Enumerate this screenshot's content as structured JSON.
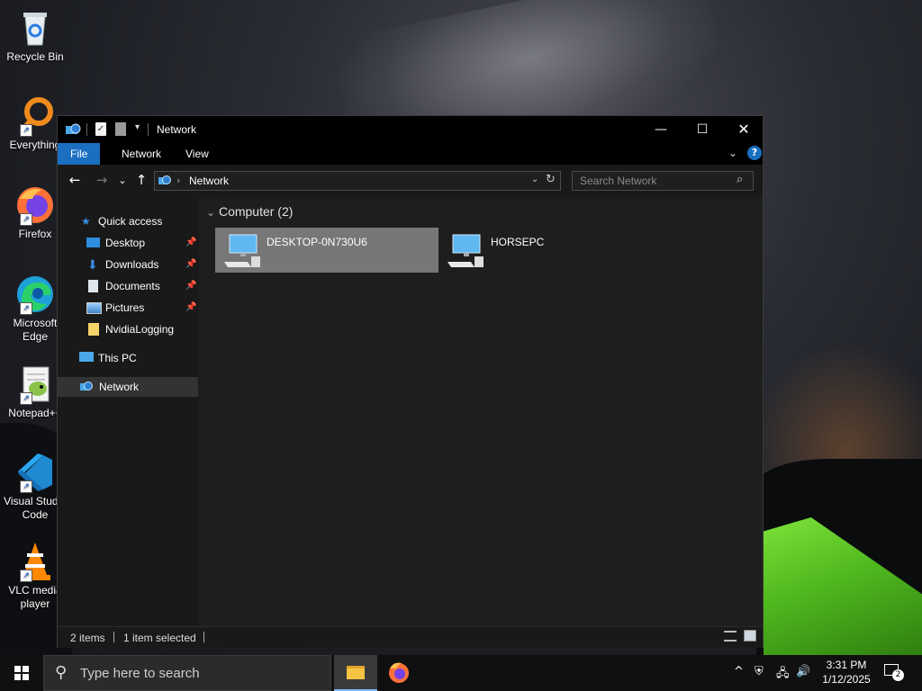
{
  "desktop": {
    "icons": [
      {
        "label": "Recycle Bin",
        "icon": "recycle-bin-icon"
      },
      {
        "label": "Everything",
        "icon": "everything-icon"
      },
      {
        "label": "Firefox",
        "icon": "firefox-icon"
      },
      {
        "label": "Microsoft Edge",
        "label_l1": "Microsoft",
        "label_l2": "Edge",
        "icon": "edge-icon"
      },
      {
        "label": "Notepad++",
        "icon": "notepadpp-icon"
      },
      {
        "label": "Visual Studio Code",
        "label_l1": "Visual Studio",
        "label_l2": "Code",
        "icon": "vscode-icon"
      },
      {
        "label": "VLC media player",
        "label_l1": "VLC media",
        "label_l2": "player",
        "icon": "vlc-icon"
      }
    ]
  },
  "window": {
    "title": "Network",
    "ribbon_tabs": [
      "File",
      "Network",
      "View"
    ],
    "address": {
      "path": "Network"
    },
    "search": {
      "placeholder": "Search Network"
    },
    "nav": {
      "quick_access": "Quick access",
      "items": [
        {
          "label": "Desktop",
          "pinned": true
        },
        {
          "label": "Downloads",
          "pinned": true
        },
        {
          "label": "Documents",
          "pinned": true
        },
        {
          "label": "Pictures",
          "pinned": true
        },
        {
          "label": "NvidiaLogging",
          "pinned": false
        }
      ],
      "this_pc": "This PC",
      "network": "Network"
    },
    "content": {
      "group_header": "Computer (2)",
      "items": [
        {
          "name": "DESKTOP-0N730U6",
          "selected": true
        },
        {
          "name": "HORSEPC",
          "selected": false
        }
      ]
    },
    "status": {
      "items": "2 items",
      "selected": "1 item selected"
    }
  },
  "taskbar": {
    "search_placeholder": "Type here to search",
    "time": "3:31 PM",
    "date": "1/12/2025",
    "notifications": "2"
  },
  "colors": {
    "accent": "#1a6fc1",
    "selection": "#777777",
    "window_bg": "#191919"
  }
}
